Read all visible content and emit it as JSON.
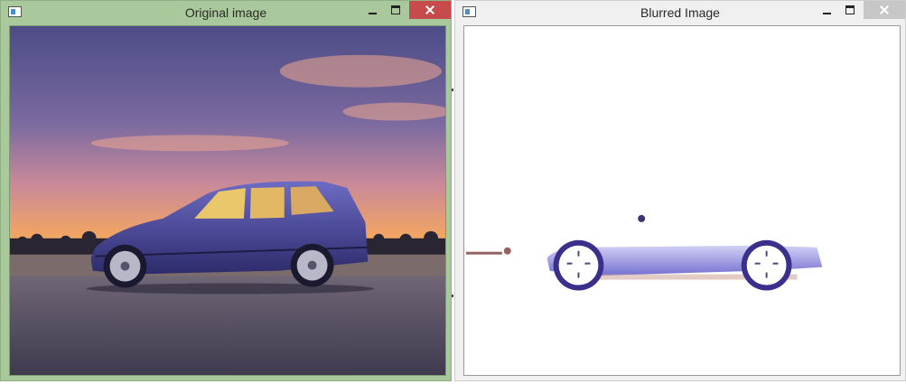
{
  "windows": {
    "left": {
      "title": "Original image"
    },
    "right": {
      "title": "Blurred Image"
    }
  },
  "icons": [
    "app-icon",
    "minimize-icon",
    "maximize-icon",
    "close-icon"
  ],
  "colors": {
    "left_frame": "#a9c89b",
    "right_frame": "#f0f0f0",
    "close_active": "#c74b4b",
    "close_inactive": "#c7c7c7",
    "sky_top": "#4f4f8a",
    "sunset": "#f4b23a",
    "car_body": "#5a5aa8"
  }
}
